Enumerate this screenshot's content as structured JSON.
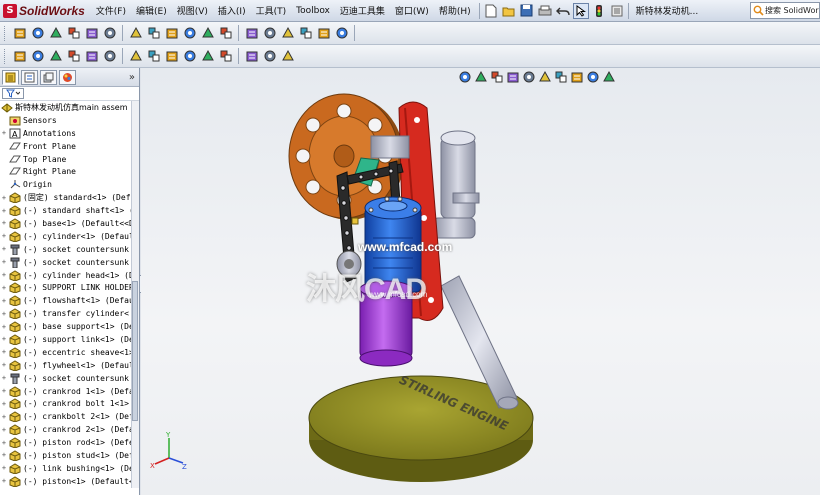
{
  "app": {
    "name": "SolidWorks",
    "document_title": "斯特林发动机..."
  },
  "menu": [
    "文件(F)",
    "编辑(E)",
    "视图(V)",
    "插入(I)",
    "工具(T)",
    "Toolbox",
    "迈迪工具集",
    "窗口(W)",
    "帮助(H)"
  ],
  "search": {
    "value": "搜索 SolidWorks"
  },
  "icons": {
    "title_toolbar": [
      "new-document-icon",
      "open-icon",
      "save-icon",
      "print-icon",
      "undo-icon",
      "select-icon",
      "traffic-light-icon",
      "options-icon"
    ],
    "toolbar1": [
      "smart-mate-icon",
      "edit-component-icon",
      "insert-component-icon",
      "mate-icon",
      "linear-pattern-icon",
      "move-component-icon",
      "rotate-component-icon",
      "hide-show-icon",
      "explode-icon",
      "interference-icon",
      "assembly-feature-icon",
      "reference-geometry-icon",
      "new-motion-study-icon",
      "bill-of-materials-icon",
      "exploded-view-icon",
      "explode-line-icon",
      "instant3d-icon",
      "large-assembly-icon"
    ],
    "toolbar2": [
      "sketch-icon",
      "smart-dimension-icon",
      "note-icon",
      "surface-finish-icon",
      "weld-symbol-icon",
      "datum-icon",
      "geometric-tolerance-icon",
      "balloon-icon",
      "auto-balloon-icon",
      "hole-callout-icon",
      "table-icon",
      "line-icon",
      "rectangle-icon",
      "circle-icon",
      "arc-icon"
    ],
    "heads_up": [
      "zoom-to-fit-icon",
      "zoom-area-icon",
      "previous-view-icon",
      "section-view-icon",
      "view-orientation-icon",
      "display-style-icon",
      "hide-show-items-icon",
      "edit-appearance-icon",
      "apply-scene-icon",
      "view-settings-icon"
    ],
    "tree_tabs": [
      "feature-manager-tab-icon",
      "property-manager-tab-icon",
      "configuration-manager-tab-icon",
      "display-manager-tab-icon"
    ]
  },
  "tree": {
    "root": "斯特林发动机仿真main assem",
    "items": [
      {
        "label": "Sensors",
        "icon": "sensors-icon",
        "expand": ""
      },
      {
        "label": "Annotations",
        "icon": "annotations-icon",
        "expand": "+"
      },
      {
        "label": "Front Plane",
        "icon": "plane-icon",
        "expand": ""
      },
      {
        "label": "Top Plane",
        "icon": "plane-icon",
        "expand": ""
      },
      {
        "label": "Right Plane",
        "icon": "plane-icon",
        "expand": ""
      },
      {
        "label": "Origin",
        "icon": "origin-icon",
        "expand": ""
      },
      {
        "label": "(固定) standard<1> (Def",
        "icon": "part-icon",
        "expand": "+"
      },
      {
        "label": "(-) standard shaft<1> (",
        "icon": "part-icon",
        "expand": "+"
      },
      {
        "label": "(-) base<1> (Default<<D",
        "icon": "part-icon",
        "expand": "+"
      },
      {
        "label": "(-) cylinder<1> (Defaul",
        "icon": "part-icon",
        "expand": "+"
      },
      {
        "label": "(-) socket countersunk",
        "icon": "toolbox-part-icon",
        "expand": "+"
      },
      {
        "label": "(-) socket countersunk",
        "icon": "toolbox-part-icon",
        "expand": "+"
      },
      {
        "label": "(-) cylinder head<1> (D",
        "icon": "part-icon",
        "expand": "+"
      },
      {
        "label": "(-) SUPPORT LINK HOLDER",
        "icon": "part-icon",
        "expand": "+"
      },
      {
        "label": "(-) flowshaft<1> (Defau",
        "icon": "part-icon",
        "expand": "+"
      },
      {
        "label": "(-) transfer cylinder<",
        "icon": "part-icon",
        "expand": "+"
      },
      {
        "label": "(-) base support<1> (De",
        "icon": "part-icon",
        "expand": "+"
      },
      {
        "label": "(-) support link<1> (De",
        "icon": "part-icon",
        "expand": "+"
      },
      {
        "label": "(-) eccentric sheave<1>",
        "icon": "part-icon",
        "expand": "+"
      },
      {
        "label": "(-) flywheel<1> (Defaul",
        "icon": "part-icon",
        "expand": "+"
      },
      {
        "label": "(-) socket countersunk",
        "icon": "toolbox-part-icon",
        "expand": "+"
      },
      {
        "label": "(-) crankrod 1<1> (Defa",
        "icon": "part-icon",
        "expand": "+"
      },
      {
        "label": "(-) crankrod bolt 1<1>",
        "icon": "part-icon",
        "expand": "+"
      },
      {
        "label": "(-) crankbolt 2<1> (Def",
        "icon": "part-icon",
        "expand": "+"
      },
      {
        "label": "(-) crankrod 2<1> (Defa",
        "icon": "part-icon",
        "expand": "+"
      },
      {
        "label": "(-) piston rod<1> (Defe",
        "icon": "part-icon",
        "expand": "+"
      },
      {
        "label": "(-) piston stud<1> (Def",
        "icon": "part-icon",
        "expand": "+"
      },
      {
        "label": "(-) link bushing<1> (De",
        "icon": "part-icon",
        "expand": "+"
      },
      {
        "label": "(-) piston<1> (Default<",
        "icon": "part-icon",
        "expand": "+"
      }
    ]
  },
  "viewport": {
    "watermark_url": "www.mfcad.com",
    "watermark_logo": "沐风CAD",
    "watermark_sub": "www.mfcad.com",
    "base_engraving": "STIRLING ENGINE",
    "triad": {
      "x": "X",
      "y": "Y",
      "z": "Z"
    },
    "colors": {
      "flywheel": "#c9691f",
      "frame": "#d62a1f",
      "cylinder": "#1f5fd0",
      "piston": "#a23fd4",
      "base": "#8f8c22",
      "support": "#b9bccb",
      "linkage": "#2a2a2a"
    }
  }
}
